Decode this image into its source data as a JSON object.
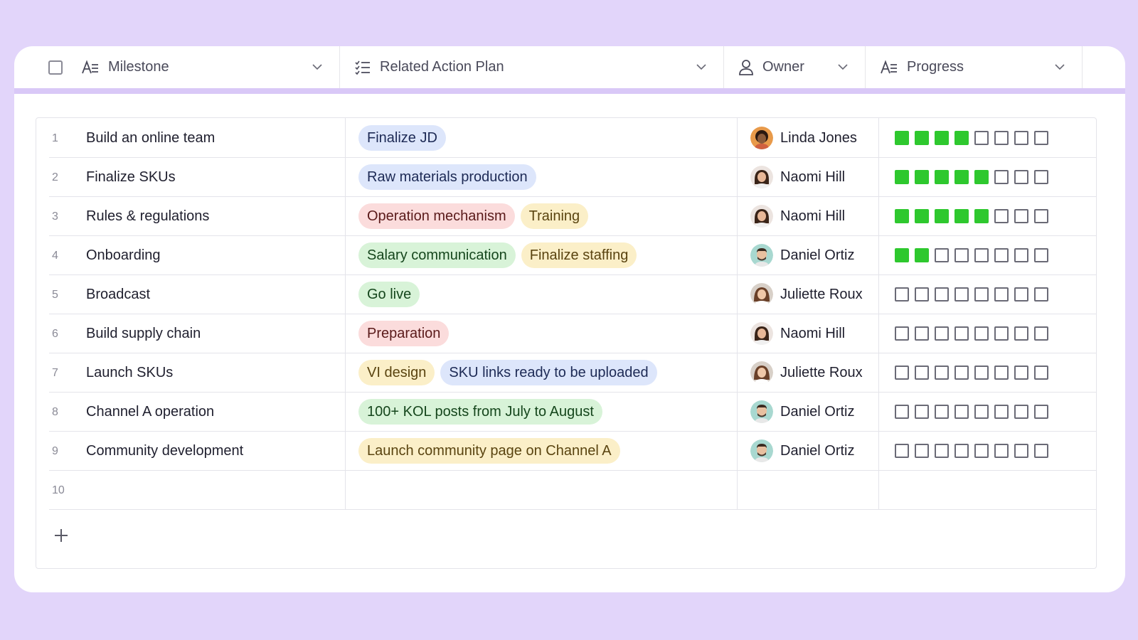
{
  "header": {
    "milestone_label": "Milestone",
    "plan_label": "Related Action Plan",
    "owner_label": "Owner",
    "progress_label": "Progress"
  },
  "colors": {
    "background": "#e2d5fa",
    "header_bar": "#d9c8f7",
    "progress_fill": "#2ec82e"
  },
  "progress_total": 8,
  "rows": [
    {
      "num": "1",
      "milestone": "Build an online team",
      "plans": [
        {
          "text": "Finalize JD",
          "color": "blue"
        }
      ],
      "owner": "Linda Jones",
      "avatar": "linda",
      "progress": 4
    },
    {
      "num": "2",
      "milestone": "Finalize SKUs",
      "plans": [
        {
          "text": "Raw materials production",
          "color": "blue"
        }
      ],
      "owner": "Naomi Hill",
      "avatar": "naomi",
      "progress": 5
    },
    {
      "num": "3",
      "milestone": "Rules & regulations",
      "plans": [
        {
          "text": "Operation mechanism",
          "color": "red"
        },
        {
          "text": "Training",
          "color": "yellow"
        }
      ],
      "owner": "Naomi Hill",
      "avatar": "naomi",
      "progress": 5
    },
    {
      "num": "4",
      "milestone": "Onboarding",
      "plans": [
        {
          "text": "Salary communication",
          "color": "green"
        },
        {
          "text": "Finalize staffing",
          "color": "yellow"
        }
      ],
      "owner": "Daniel Ortiz",
      "avatar": "daniel",
      "progress": 2
    },
    {
      "num": "5",
      "milestone": "Broadcast",
      "plans": [
        {
          "text": "Go live",
          "color": "green"
        }
      ],
      "owner": "Juliette Roux",
      "avatar": "juliette",
      "progress": 0
    },
    {
      "num": "6",
      "milestone": "Build supply chain",
      "plans": [
        {
          "text": "Preparation",
          "color": "red"
        }
      ],
      "owner": "Naomi Hill",
      "avatar": "naomi",
      "progress": 0
    },
    {
      "num": "7",
      "milestone": "Launch SKUs",
      "plans": [
        {
          "text": "VI design",
          "color": "yellow"
        },
        {
          "text": "SKU links ready to be uploaded",
          "color": "blue"
        }
      ],
      "owner": "Juliette Roux",
      "avatar": "juliette",
      "progress": 0
    },
    {
      "num": "8",
      "milestone": "Channel A operation",
      "plans": [
        {
          "text": "100+ KOL posts from July to August",
          "color": "green"
        }
      ],
      "owner": "Daniel Ortiz",
      "avatar": "daniel",
      "progress": 0
    },
    {
      "num": "9",
      "milestone": "Community development",
      "plans": [
        {
          "text": "Launch community page on Channel A",
          "color": "yellow"
        }
      ],
      "owner": "Daniel Ortiz",
      "avatar": "daniel",
      "progress": 0
    },
    {
      "num": "10",
      "milestone": "",
      "plans": [],
      "owner": "",
      "avatar": "",
      "progress": 0
    }
  ]
}
